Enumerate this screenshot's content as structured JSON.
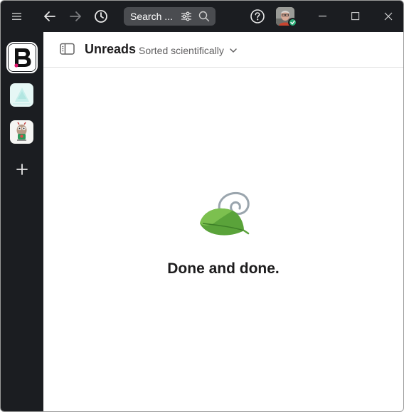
{
  "search": {
    "label": "Search ..."
  },
  "header": {
    "title": "Unreads",
    "sort_label": "Sorted scientifically"
  },
  "empty_state": {
    "message": "Done and done."
  },
  "workspaces": [
    {
      "name_letter": "B",
      "active": true
    },
    {
      "name_letter": "",
      "active": false
    },
    {
      "name_letter": "",
      "active": false
    }
  ],
  "colors": {
    "titlebar": "#1b1d21",
    "search_bg": "#4a4c50",
    "status_online": "#2bac76",
    "accent_pink": "#e0156d",
    "leaf_green": "#5aa33a"
  },
  "icons": [
    "menu-icon",
    "back-arrow-icon",
    "forward-arrow-icon",
    "history-icon",
    "filter-icon",
    "search-icon",
    "help-icon",
    "minimize-icon",
    "maximize-icon",
    "close-icon",
    "sidebar-toggle-icon",
    "chevron-down-icon",
    "plus-icon",
    "leaf-illustration"
  ]
}
